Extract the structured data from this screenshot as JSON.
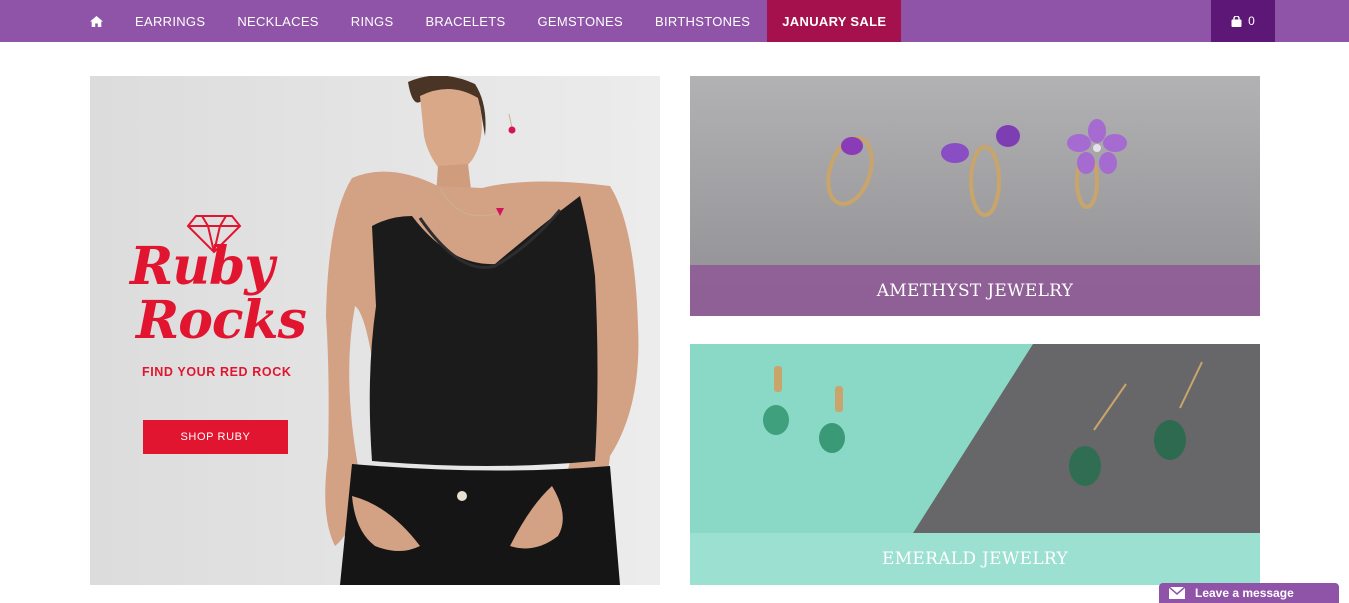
{
  "nav": {
    "home_icon": "home-icon",
    "items": [
      {
        "label": "EARRINGS"
      },
      {
        "label": "NECKLACES"
      },
      {
        "label": "RINGS"
      },
      {
        "label": "BRACELETS"
      },
      {
        "label": "GEMSTONES"
      },
      {
        "label": "BIRTHSTONES"
      }
    ],
    "sale_label": "JANUARY SALE",
    "cart_icon": "shopping-bag-icon",
    "cart_count": "0"
  },
  "hero": {
    "title_line1": "Ruby",
    "title_line2": "Rocks",
    "subtitle": "FIND YOUR RED ROCK",
    "button_label": "SHOP RUBY"
  },
  "tiles": {
    "amethyst_caption": "AMETHYST JEWELRY",
    "emerald_caption": "EMERALD JEWELRY"
  },
  "chat": {
    "label": "Leave a message",
    "icon": "envelope-icon"
  },
  "colors": {
    "nav_bg": "#8f54a8",
    "sale_bg": "#a4114d",
    "cart_bg": "#5d1777",
    "ruby_red": "#e1152f",
    "amethyst_caption_bg": "#8e5e96",
    "emerald_caption_bg": "#9ce0d2"
  }
}
